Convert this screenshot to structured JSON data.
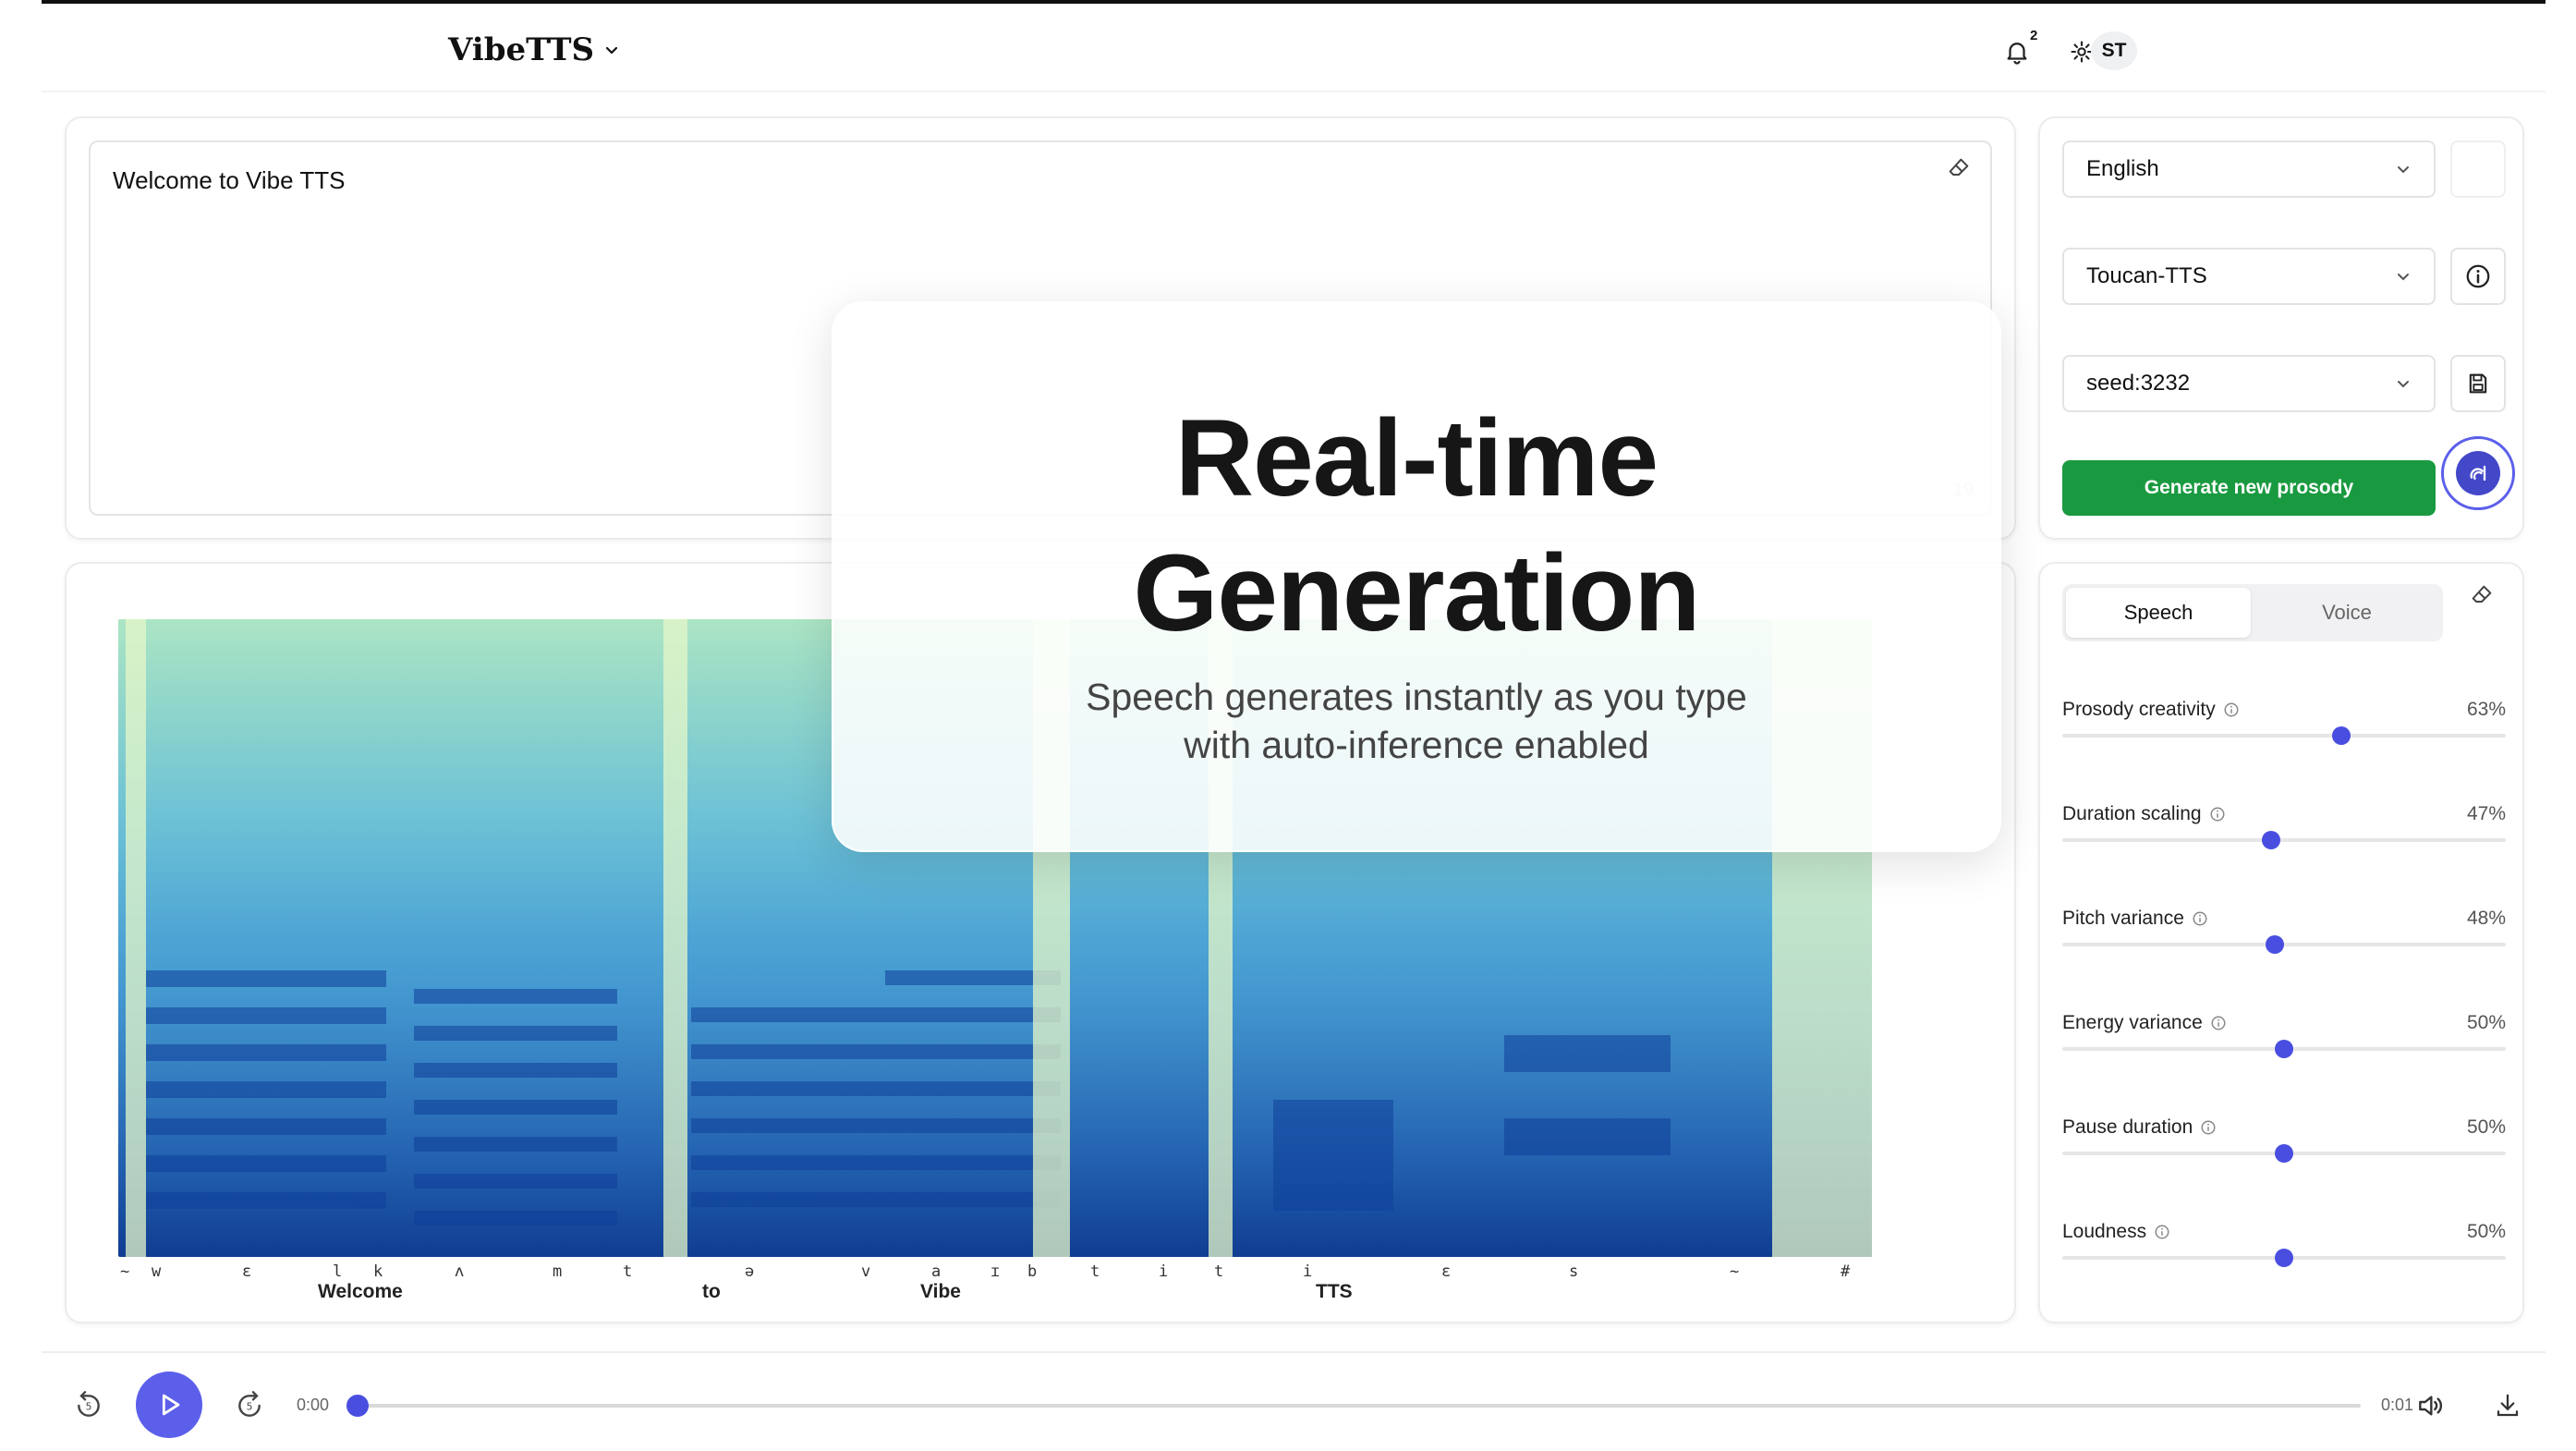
{
  "header": {
    "brand": "VibeTTS",
    "notification_count": "2",
    "avatar_initials": "ST"
  },
  "editor": {
    "text": "Welcome to Vibe TTS",
    "char_count": "19"
  },
  "controls": {
    "language": "English",
    "model": "Toucan-TTS",
    "seed": "seed:3232",
    "generate_label": "Generate new prosody"
  },
  "params": {
    "tabs": {
      "speech": "Speech",
      "voice": "Voice"
    },
    "items": [
      {
        "label": "Prosody creativity",
        "value_text": "63%",
        "value": 0.63
      },
      {
        "label": "Duration scaling",
        "value_text": "47%",
        "value": 0.47
      },
      {
        "label": "Pitch variance",
        "value_text": "48%",
        "value": 0.48
      },
      {
        "label": "Energy variance",
        "value_text": "50%",
        "value": 0.5
      },
      {
        "label": "Pause duration",
        "value_text": "50%",
        "value": 0.5
      },
      {
        "label": "Loudness",
        "value_text": "50%",
        "value": 0.5
      }
    ]
  },
  "spectrogram": {
    "phonemes": [
      "~",
      "w",
      "ɛ",
      "l",
      "k",
      "ʌ",
      "m",
      "t",
      "ə",
      "v",
      "a",
      "ɪ",
      "b",
      "t",
      "i",
      "t",
      "i",
      "ɛ",
      "s",
      "~",
      "#"
    ],
    "words": [
      "Welcome",
      "to",
      "Vibe",
      "TTS"
    ]
  },
  "player": {
    "current_time": "0:00",
    "duration": "0:01",
    "progress": 0
  },
  "overlay": {
    "title": "Real-time\nGeneration",
    "subtitle": "Speech generates instantly as you type\nwith auto-inference enabled"
  },
  "colors": {
    "accent": "#5b5fea",
    "generate": "#1a9a40",
    "slider_thumb": "#4a4ee0"
  }
}
